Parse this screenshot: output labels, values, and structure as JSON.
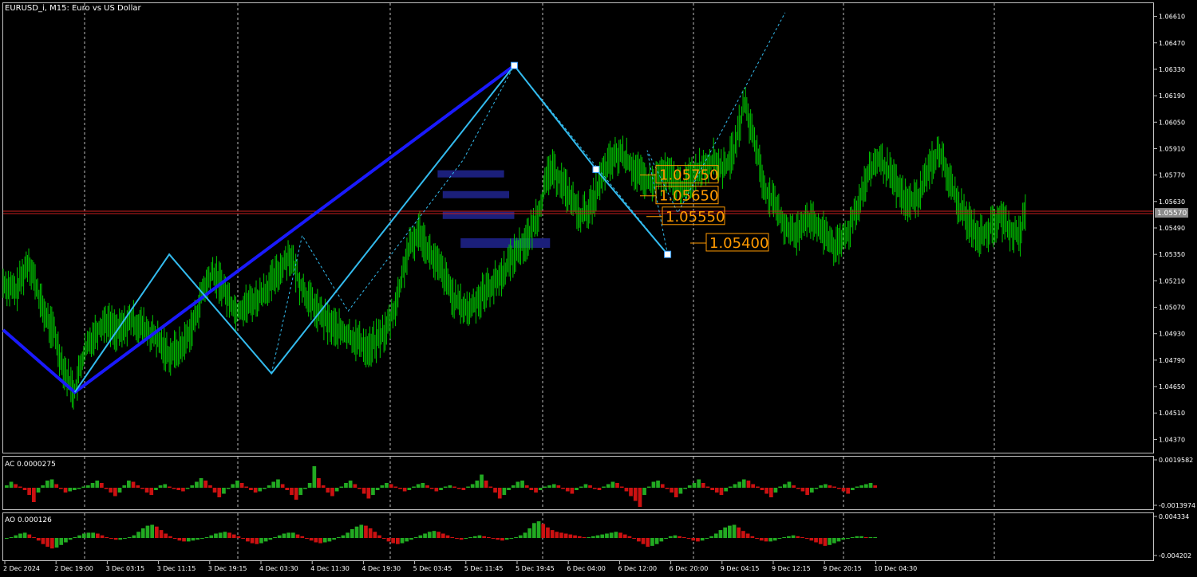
{
  "main_panel": {
    "title": "EURUSD_i, M15:  Euro vs US Dollar",
    "y_ticks": [
      "1.06610",
      "1.06470",
      "1.06330",
      "1.06190",
      "1.06050",
      "1.05910",
      "1.05770",
      "1.05630",
      "1.05490",
      "1.05350",
      "1.05210",
      "1.05070",
      "1.04930",
      "1.04790",
      "1.04650",
      "1.04510",
      "1.04370"
    ],
    "current_price": "1.05570",
    "price_labels": [
      "1.05750",
      "1.05650",
      "1.05550",
      "1.05400"
    ]
  },
  "ac_panel": {
    "title": "AC 0.0000275",
    "y_ticks": [
      "0.0019582",
      "-0.0013974"
    ]
  },
  "ao_panel": {
    "title": "AO 0.000126",
    "y_ticks": [
      "0.004334",
      "-0.004202"
    ]
  },
  "x_ticks": [
    "2 Dec 2024",
    "2 Dec 19:00",
    "3 Dec 03:15",
    "3 Dec 11:15",
    "3 Dec 19:15",
    "4 Dec 03:30",
    "4 Dec 11:30",
    "4 Dec 19:30",
    "5 Dec 03:45",
    "5 Dec 11:45",
    "5 Dec 19:45",
    "6 Dec 04:00",
    "6 Dec 12:00",
    "6 Dec 20:00",
    "9 Dec 04:15",
    "9 Dec 12:15",
    "9 Dec 20:15",
    "10 Dec 04:30"
  ],
  "colors": {
    "background": "#000000",
    "candle": "#00c800",
    "zigzag_major": "#1a1aff",
    "zigzag_minor": "#33bbee",
    "price_label": "#ff9900",
    "zone": "#1b1f7a",
    "current_price_line": "#c81e1e",
    "osc_up": "#22aa22",
    "osc_down": "#cc1111"
  },
  "chart_data": {
    "type": "line",
    "symbol": "EURUSD_i",
    "timeframe": "M15",
    "ylim": [
      1.043,
      1.0668
    ],
    "current_price": 1.0557,
    "price_path": [
      [
        0,
        1.052
      ],
      [
        5,
        1.0515
      ],
      [
        10,
        1.0532
      ],
      [
        15,
        1.0508
      ],
      [
        18,
        1.0498
      ],
      [
        20,
        1.0494
      ],
      [
        22,
        1.0482
      ],
      [
        25,
        1.047
      ],
      [
        28,
        1.0462
      ],
      [
        31,
        1.048
      ],
      [
        35,
        1.0492
      ],
      [
        40,
        1.05
      ],
      [
        45,
        1.0494
      ],
      [
        50,
        1.05
      ],
      [
        55,
        1.0496
      ],
      [
        60,
        1.049
      ],
      [
        65,
        1.0482
      ],
      [
        70,
        1.0486
      ],
      [
        75,
        1.05
      ],
      [
        78,
        1.0515
      ],
      [
        82,
        1.0525
      ],
      [
        85,
        1.052
      ],
      [
        88,
        1.0512
      ],
      [
        91,
        1.0505
      ],
      [
        95,
        1.0508
      ],
      [
        100,
        1.0512
      ],
      [
        106,
        1.0522
      ],
      [
        112,
        1.0535
      ],
      [
        116,
        1.052
      ],
      [
        120,
        1.051
      ],
      [
        126,
        1.05
      ],
      [
        132,
        1.0494
      ],
      [
        138,
        1.049
      ],
      [
        143,
        1.0485
      ],
      [
        150,
        1.0495
      ],
      [
        154,
        1.051
      ],
      [
        158,
        1.0535
      ],
      [
        163,
        1.0548
      ],
      [
        167,
        1.0535
      ],
      [
        172,
        1.0525
      ],
      [
        177,
        1.051
      ],
      [
        182,
        1.0505
      ],
      [
        188,
        1.0515
      ],
      [
        194,
        1.0522
      ],
      [
        200,
        1.0535
      ],
      [
        206,
        1.0545
      ],
      [
        210,
        1.056
      ],
      [
        214,
        1.058
      ],
      [
        218,
        1.0575
      ],
      [
        222,
        1.0565
      ],
      [
        226,
        1.0555
      ],
      [
        230,
        1.056
      ],
      [
        234,
        1.0575
      ],
      [
        238,
        1.0585
      ],
      [
        242,
        1.0588
      ],
      [
        246,
        1.0582
      ],
      [
        250,
        1.0575
      ],
      [
        254,
        1.0572
      ],
      [
        258,
        1.0578
      ],
      [
        262,
        1.0575
      ],
      [
        266,
        1.057
      ],
      [
        270,
        1.0578
      ],
      [
        274,
        1.0582
      ],
      [
        278,
        1.0585
      ],
      [
        282,
        1.058
      ],
      [
        286,
        1.059
      ],
      [
        290,
        1.0615
      ],
      [
        294,
        1.0595
      ],
      [
        298,
        1.057
      ],
      [
        302,
        1.056
      ],
      [
        306,
        1.055
      ],
      [
        310,
        1.0545
      ],
      [
        314,
        1.0555
      ],
      [
        318,
        1.055
      ],
      [
        322,
        1.0545
      ],
      [
        326,
        1.0538
      ],
      [
        330,
        1.0545
      ],
      [
        334,
        1.056
      ],
      [
        338,
        1.0575
      ],
      [
        342,
        1.0585
      ],
      [
        346,
        1.058
      ],
      [
        350,
        1.057
      ],
      [
        354,
        1.0562
      ],
      [
        358,
        1.0565
      ],
      [
        362,
        1.058
      ],
      [
        366,
        1.059
      ],
      [
        370,
        1.0575
      ],
      [
        374,
        1.056
      ],
      [
        378,
        1.0552
      ],
      [
        382,
        1.0545
      ],
      [
        386,
        1.0548
      ],
      [
        390,
        1.0555
      ],
      [
        394,
        1.0548
      ],
      [
        398,
        1.0545
      ],
      [
        400,
        1.0557
      ]
    ],
    "zigzag_major": [
      [
        0,
        1.0495
      ],
      [
        28,
        1.0462
      ],
      [
        200,
        1.0635
      ]
    ],
    "zigzag_minor": [
      [
        28,
        1.0462
      ],
      [
        65,
        1.0535
      ],
      [
        105,
        1.0472
      ],
      [
        200,
        1.0635
      ],
      [
        232,
        1.058
      ],
      [
        260,
        1.0535
      ]
    ],
    "zigzag_dotted": [
      [
        105,
        1.0472
      ],
      [
        117,
        1.0545
      ],
      [
        135,
        1.0505
      ],
      [
        180,
        1.0585
      ],
      [
        200,
        1.0635
      ],
      [
        260,
        1.0535
      ],
      [
        252,
        1.059
      ],
      [
        264,
        1.0557
      ],
      [
        306,
        1.0663
      ]
    ],
    "zones": [
      {
        "label": "1.05750",
        "price": 1.0577,
        "x0": 170,
        "x1": 196
      },
      {
        "label": "1.05650",
        "price": 1.0566,
        "x0": 172,
        "x1": 198
      },
      {
        "label": "1.05550",
        "price": 1.0555,
        "x0": 172,
        "x1": 200
      },
      {
        "label": "1.05400",
        "price": 1.0541,
        "x0": 179,
        "x1": 214
      }
    ],
    "osc_ylim": [
      -1,
      1
    ],
    "ac_values": [
      0.1,
      0.25,
      0.15,
      0.05,
      -0.1,
      -0.3,
      -0.6,
      -0.2,
      0.1,
      0.3,
      0.35,
      0.15,
      -0.05,
      -0.2,
      -0.15,
      -0.1,
      -0.05,
      0.05,
      0.1,
      0.2,
      0.3,
      0.2,
      -0.05,
      -0.2,
      -0.35,
      -0.2,
      0.1,
      0.3,
      0.25,
      0.1,
      -0.05,
      -0.2,
      -0.3,
      -0.1,
      0.1,
      0.15,
      0.05,
      -0.05,
      -0.1,
      -0.15,
      -0.05,
      0.1,
      0.25,
      0.4,
      0.3,
      0.1,
      -0.2,
      -0.4,
      -0.25,
      -0.05,
      0.15,
      0.3,
      0.2,
      0.05,
      -0.1,
      -0.2,
      -0.15,
      -0.05,
      0.1,
      0.25,
      0.35,
      0.15,
      -0.1,
      -0.3,
      -0.5,
      -0.3,
      -0.05,
      0.2,
      0.9,
      0.4,
      0.1,
      -0.2,
      -0.35,
      -0.15,
      0.05,
      0.2,
      0.3,
      0.15,
      -0.05,
      -0.25,
      -0.45,
      -0.3,
      -0.1,
      0.1,
      0.2,
      0.15,
      0.05,
      -0.05,
      -0.15,
      -0.1,
      0.05,
      0.15,
      0.2,
      0.1,
      -0.05,
      -0.15,
      -0.1,
      0.05,
      0.1,
      0.05,
      -0.05,
      -0.1,
      0.05,
      0.15,
      0.3,
      0.55,
      0.3,
      0.05,
      -0.2,
      -0.45,
      -0.3,
      -0.1,
      0.1,
      0.25,
      0.3,
      0.1,
      -0.1,
      -0.2,
      -0.1,
      0.05,
      0.1,
      0.15,
      0.1,
      -0.05,
      -0.15,
      -0.25,
      -0.1,
      0.05,
      0.15,
      0.1,
      -0.05,
      -0.1,
      0.05,
      0.15,
      0.25,
      0.2,
      0.05,
      -0.15,
      -0.35,
      -0.55,
      -0.8,
      -0.3,
      0.05,
      0.25,
      0.3,
      0.15,
      -0.05,
      -0.2,
      -0.4,
      -0.25,
      -0.05,
      0.1,
      0.2,
      0.35,
      0.2,
      0.05,
      -0.1,
      -0.2,
      -0.3,
      -0.15,
      0.05,
      0.15,
      0.25,
      0.35,
      0.3,
      0.15,
      0.05,
      -0.1,
      -0.25,
      -0.4,
      -0.2,
      0.05,
      0.15,
      0.25,
      0.1,
      -0.05,
      -0.15,
      -0.3,
      -0.2,
      -0.05,
      0.1,
      0.15,
      0.1,
      0.05,
      -0.05,
      -0.15,
      -0.25,
      -0.1,
      0.05,
      0.1,
      0.15,
      0.2,
      0.1
    ],
    "ao_values": [
      -0.05,
      0.05,
      0.15,
      0.25,
      0.3,
      0.2,
      0.05,
      -0.15,
      -0.35,
      -0.5,
      -0.6,
      -0.55,
      -0.4,
      -0.25,
      -0.1,
      0.05,
      0.15,
      0.25,
      0.3,
      0.3,
      0.25,
      0.15,
      0.05,
      -0.05,
      -0.1,
      -0.1,
      -0.05,
      0.05,
      0.15,
      0.35,
      0.55,
      0.7,
      0.75,
      0.65,
      0.45,
      0.25,
      0.1,
      -0.05,
      -0.15,
      -0.2,
      -0.2,
      -0.15,
      -0.1,
      -0.05,
      0.05,
      0.15,
      0.25,
      0.3,
      0.35,
      0.3,
      0.2,
      0.1,
      -0.05,
      -0.2,
      -0.3,
      -0.35,
      -0.3,
      -0.2,
      -0.1,
      0.05,
      0.15,
      0.25,
      0.3,
      0.3,
      0.2,
      0.1,
      -0.05,
      -0.15,
      -0.25,
      -0.3,
      -0.25,
      -0.2,
      -0.1,
      0.05,
      0.15,
      0.3,
      0.5,
      0.65,
      0.75,
      0.7,
      0.55,
      0.35,
      0.15,
      -0.05,
      -0.2,
      -0.3,
      -0.35,
      -0.3,
      -0.2,
      -0.1,
      0.05,
      0.15,
      0.25,
      0.35,
      0.4,
      0.35,
      0.25,
      0.15,
      0.05,
      -0.05,
      -0.1,
      -0.05,
      0.05,
      0.1,
      0.15,
      0.1,
      0.05,
      -0.05,
      -0.1,
      -0.15,
      -0.1,
      -0.05,
      0.05,
      0.15,
      0.3,
      0.55,
      0.85,
      0.95,
      0.8,
      0.6,
      0.45,
      0.35,
      0.3,
      0.25,
      0.2,
      0.15,
      0.1,
      0.05,
      0.05,
      0.1,
      0.15,
      0.2,
      0.25,
      0.3,
      0.35,
      0.3,
      0.2,
      0.1,
      -0.05,
      -0.2,
      -0.35,
      -0.5,
      -0.45,
      -0.35,
      -0.2,
      -0.05,
      0.1,
      0.15,
      0.1,
      0.05,
      -0.05,
      -0.15,
      -0.2,
      -0.15,
      -0.05,
      0.1,
      0.25,
      0.45,
      0.6,
      0.7,
      0.75,
      0.6,
      0.4,
      0.25,
      0.1,
      -0.05,
      -0.15,
      -0.2,
      -0.2,
      -0.15,
      -0.05,
      0.05,
      0.1,
      0.15,
      0.1,
      0.05,
      -0.05,
      -0.15,
      -0.25,
      -0.35,
      -0.45,
      -0.4,
      -0.3,
      -0.2,
      -0.1,
      -0.05,
      0.05,
      0.1,
      0.1,
      0.05,
      0.05,
      0.05
    ]
  }
}
